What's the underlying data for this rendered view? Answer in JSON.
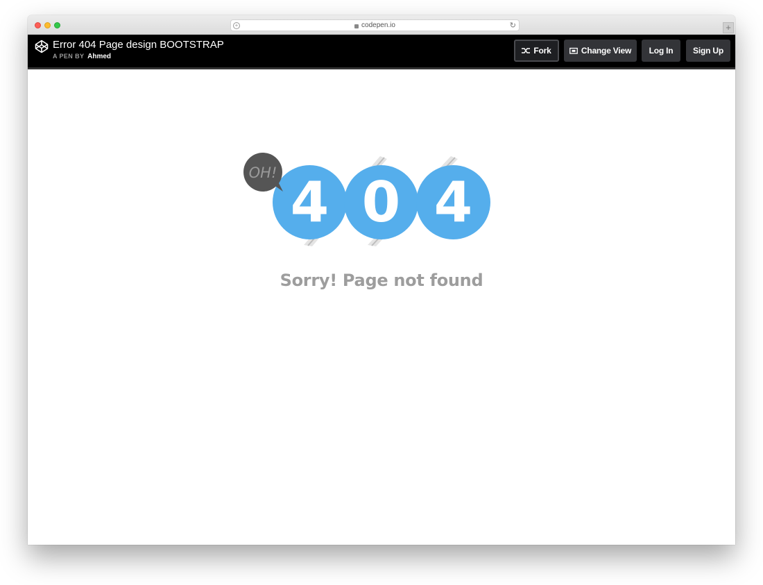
{
  "browser": {
    "url": "codepen.io"
  },
  "header": {
    "title": "Error 404 Page design BOOTSTRAP",
    "byline_prefix": "A PEN BY",
    "author": "Ahmed",
    "buttons": {
      "fork": "Fork",
      "change_view": "Change View",
      "login": "Log In",
      "signup": "Sign Up"
    }
  },
  "error": {
    "bubble_text": "OH!",
    "digits": [
      "4",
      "0",
      "4"
    ],
    "message": "Sorry! Page not found"
  },
  "colors": {
    "circle": "#55aeec",
    "bubble": "#555555",
    "message": "#9d9d9d",
    "header_bg": "#000000"
  },
  "icons": {
    "logo": "codepen-logo-icon",
    "fork": "fork-icon",
    "change_view": "change-view-icon",
    "lock": "lock-icon",
    "reload": "reload-icon"
  }
}
